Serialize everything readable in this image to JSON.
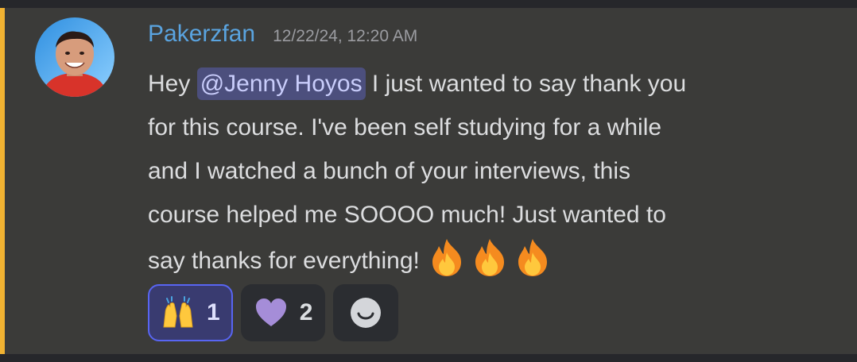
{
  "message": {
    "username": "Pakerzfan",
    "timestamp": "12/22/24, 12:20 AM",
    "content": {
      "line1_before": "Hey ",
      "mention": "@Jenny Hoyos",
      "line1_after": " I just wanted to say thank you",
      "line2": "for this course. I've been self studying for a while",
      "line3": "and I watched a bunch of your interviews, this",
      "line4": "course helped me SOOOO much! Just wanted to",
      "line5": "say thanks for everything! ",
      "trailing_emojis": [
        "fire-emoji",
        "fire-emoji",
        "fire-emoji"
      ]
    }
  },
  "reactions": [
    {
      "emoji": "raising-hands-emoji",
      "count": "1",
      "selected": true
    },
    {
      "emoji": "purple-heart-emoji",
      "count": "2",
      "selected": false
    }
  ],
  "add_reaction_icon": "smiley-icon",
  "colors": {
    "username": "#5aa4e0",
    "mention_bg": "#4c4f7d",
    "mention_text": "#c9cdfb",
    "accent_bar": "#f0b232",
    "message_bg": "#3b3b39",
    "selected_reaction_border": "#5865f2"
  }
}
